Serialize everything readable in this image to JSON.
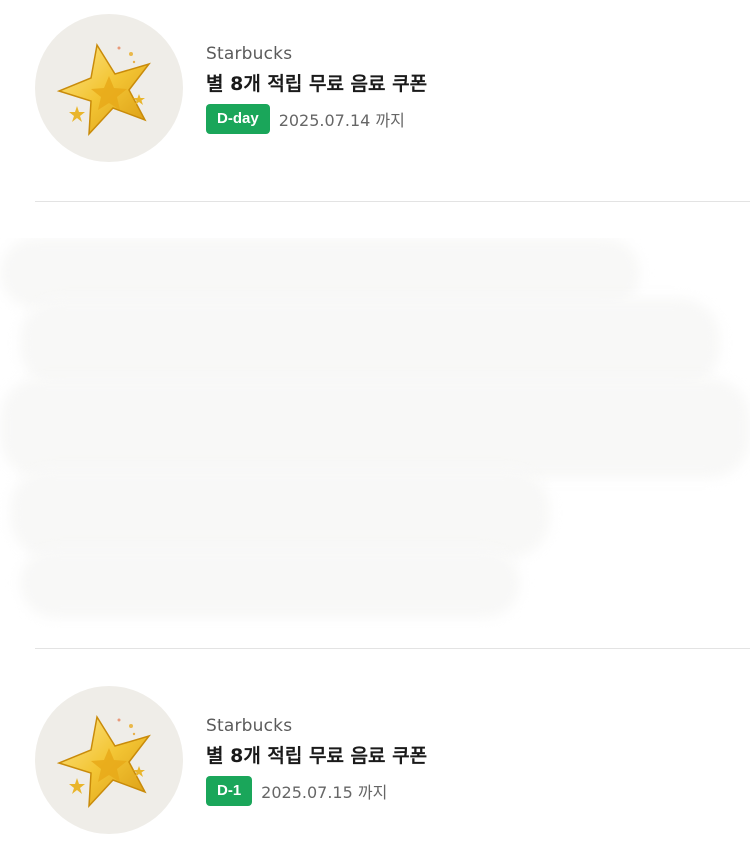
{
  "coupons": [
    {
      "brand": "Starbucks",
      "title": "별 8개 적립 무료 음료 쿠폰",
      "badge": "D-day",
      "date": "2025.07.14 까지",
      "image_icon": "gold-star-icon"
    },
    {
      "brand": "Starbucks",
      "title": "별 8개 적립 무료 음료 쿠폰",
      "badge": "D-1",
      "date": "2025.07.15 까지",
      "image_icon": "gold-star-icon"
    }
  ],
  "colors": {
    "badge_bg": "#1aa65a",
    "badge_text": "#ffffff",
    "thumb_bg": "#efede8",
    "star_gold": "#f1c232",
    "divider": "#e3e3e3"
  }
}
